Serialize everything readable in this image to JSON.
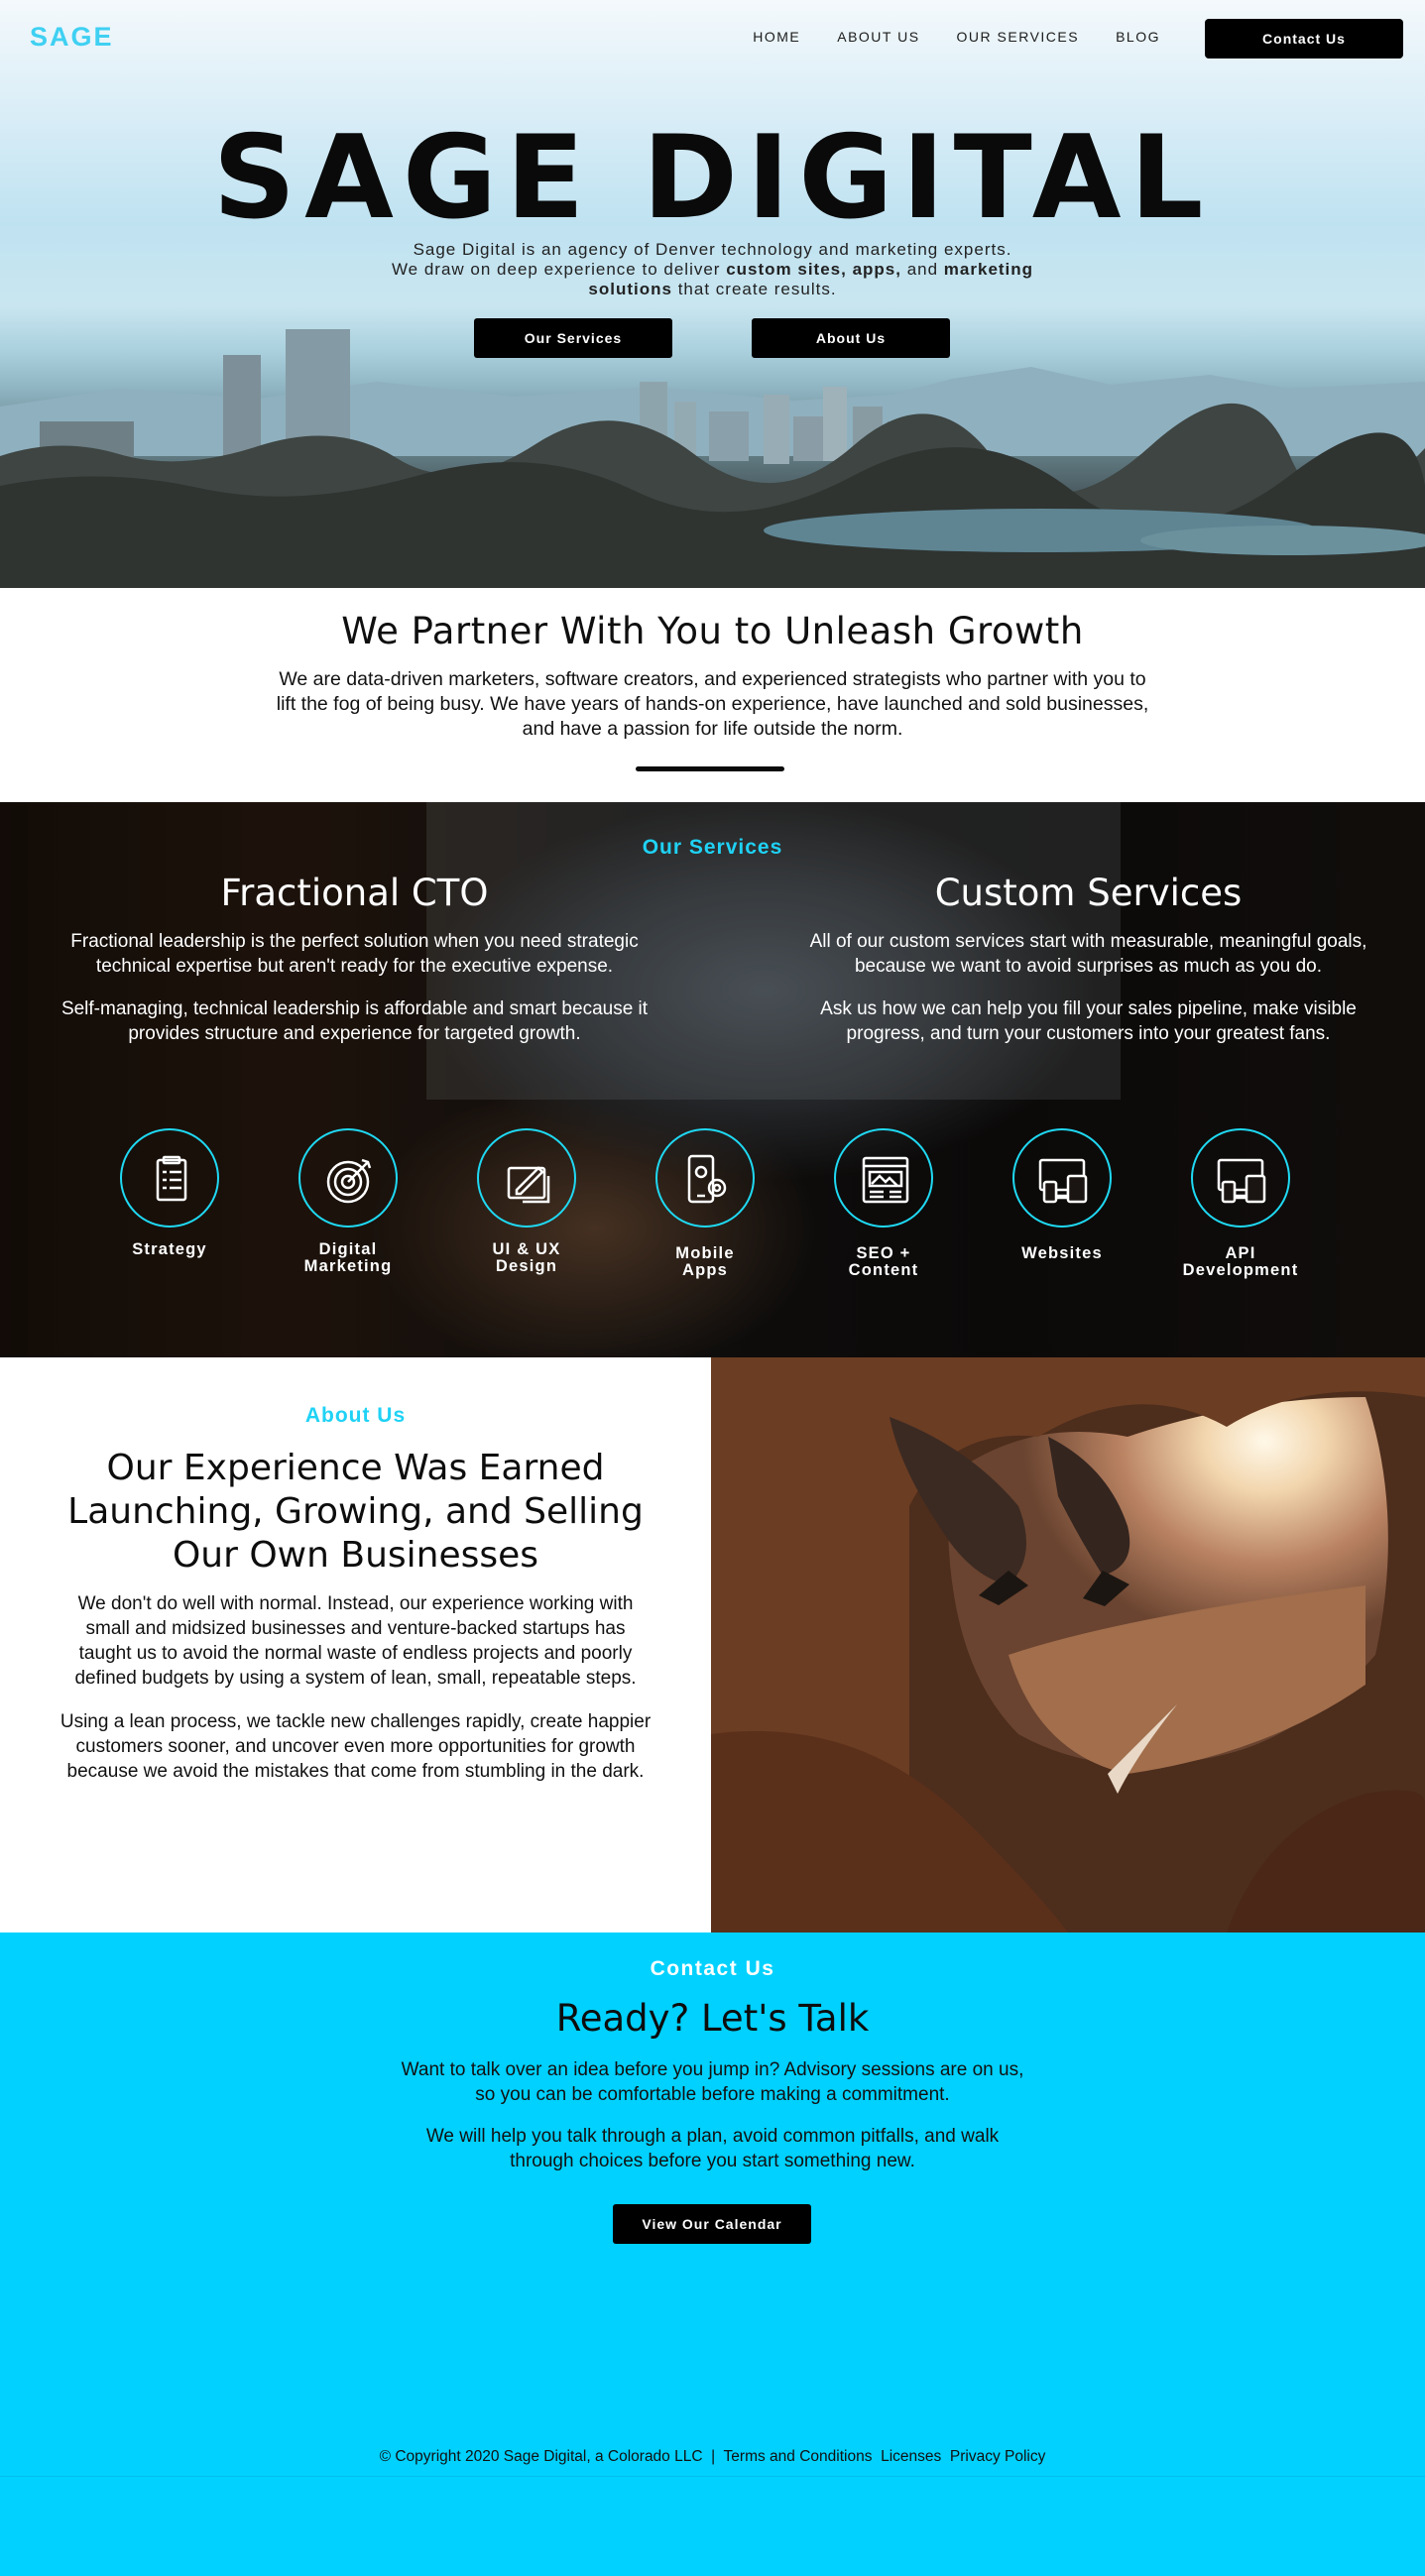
{
  "nav": {
    "logo": "SAGE",
    "links": [
      "HOME",
      "ABOUT US",
      "OUR SERVICES",
      "BLOG"
    ],
    "cta": "Contact Us"
  },
  "hero": {
    "title": "SAGE DIGITAL",
    "sub_line1": "Sage Digital is an agency of Denver technology and marketing experts.",
    "sub_line2_a": "We draw on deep experience to deliver ",
    "sub_line2_b": "custom sites, apps,",
    "sub_line2_c": " and ",
    "sub_line2_d": "marketing solutions",
    "sub_line2_e": " that create results.",
    "btn_services": "Our Services",
    "btn_about": "About Us"
  },
  "partner": {
    "title": "We Partner With You to Unleash Growth",
    "text": "We are data-driven marketers, software creators, and experienced strategists who partner with you to lift the fog of being busy. We have years of hands-on experience, have launched and sold businesses, and have a passion for life outside the norm."
  },
  "services": {
    "label": "Our Services",
    "cto": {
      "title": "Fractional CTO",
      "p1": "Fractional leadership is the perfect solution when you need strategic technical expertise but aren't ready for the executive expense.",
      "p2": "Self-managing, technical leadership is affordable and smart because it provides structure and experience for targeted growth."
    },
    "custom": {
      "title": "Custom Services",
      "p1": "All of our custom services start with measurable, meaningful goals, because we want to avoid surprises as much as you do.",
      "p2": "Ask us how we can help you fill your sales pipeline, make visible progress, and turn your customers into your greatest fans."
    },
    "items": [
      {
        "l1": "Strategy",
        "l2": "",
        "icon": "clipboard-icon"
      },
      {
        "l1": "Digital",
        "l2": "Marketing",
        "icon": "target-icon"
      },
      {
        "l1": "UI & UX",
        "l2": "Design",
        "icon": "design-tools-icon"
      },
      {
        "l1": "Mobile",
        "l2": "Apps",
        "icon": "mobile-gear-icon"
      },
      {
        "l1": "SEO +",
        "l2": "Content",
        "icon": "webpage-icon"
      },
      {
        "l1": "Websites",
        "l2": "",
        "icon": "devices-icon"
      },
      {
        "l1": "API",
        "l2": "Development",
        "icon": "devices-icon"
      }
    ]
  },
  "about": {
    "label": "About Us",
    "title": "Our Experience Was Earned Launching, Growing, and Selling Our Own Businesses",
    "p1": "We don't do well with normal. Instead, our experience working with small and midsized businesses and venture-backed startups has taught us to avoid the normal waste of endless projects and poorly defined budgets by using a system of lean, small, repeatable steps.",
    "p2": "Using a lean process, we tackle new challenges rapidly, create happier customers sooner, and uncover even more opportunities for growth because we avoid the mistakes that come from stumbling in the dark."
  },
  "contact": {
    "label": "Contact Us",
    "title": "Ready? Let's Talk",
    "p1": "Want to talk over an idea before you jump in? Advisory sessions are on us, so you can be comfortable before making a commitment.",
    "p2": "We will help you talk through a plan, avoid common pitfalls, and walk through choices before you start something new.",
    "btn": "View Our Calendar"
  },
  "footer": {
    "copyright": "© Copyright 2020 Sage Digital, a Colorado LLC",
    "sep": "|",
    "terms": "Terms and Conditions",
    "licenses": "Licenses",
    "privacy": "Privacy Policy"
  },
  "colors": {
    "accent": "#1fd2f5",
    "contact_bg": "#00d1ff",
    "button": "#000000"
  }
}
